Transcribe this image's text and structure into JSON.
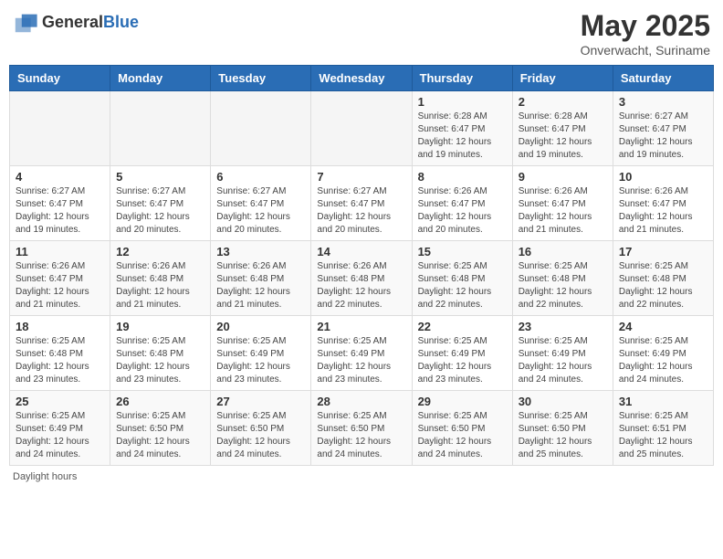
{
  "header": {
    "logo_general": "General",
    "logo_blue": "Blue",
    "main_title": "May 2025",
    "subtitle": "Onverwacht, Suriname"
  },
  "weekdays": [
    "Sunday",
    "Monday",
    "Tuesday",
    "Wednesday",
    "Thursday",
    "Friday",
    "Saturday"
  ],
  "weeks": [
    [
      {
        "day": "",
        "info": ""
      },
      {
        "day": "",
        "info": ""
      },
      {
        "day": "",
        "info": ""
      },
      {
        "day": "",
        "info": ""
      },
      {
        "day": "1",
        "info": "Sunrise: 6:28 AM\nSunset: 6:47 PM\nDaylight: 12 hours and 19 minutes."
      },
      {
        "day": "2",
        "info": "Sunrise: 6:28 AM\nSunset: 6:47 PM\nDaylight: 12 hours and 19 minutes."
      },
      {
        "day": "3",
        "info": "Sunrise: 6:27 AM\nSunset: 6:47 PM\nDaylight: 12 hours and 19 minutes."
      }
    ],
    [
      {
        "day": "4",
        "info": "Sunrise: 6:27 AM\nSunset: 6:47 PM\nDaylight: 12 hours and 19 minutes."
      },
      {
        "day": "5",
        "info": "Sunrise: 6:27 AM\nSunset: 6:47 PM\nDaylight: 12 hours and 20 minutes."
      },
      {
        "day": "6",
        "info": "Sunrise: 6:27 AM\nSunset: 6:47 PM\nDaylight: 12 hours and 20 minutes."
      },
      {
        "day": "7",
        "info": "Sunrise: 6:27 AM\nSunset: 6:47 PM\nDaylight: 12 hours and 20 minutes."
      },
      {
        "day": "8",
        "info": "Sunrise: 6:26 AM\nSunset: 6:47 PM\nDaylight: 12 hours and 20 minutes."
      },
      {
        "day": "9",
        "info": "Sunrise: 6:26 AM\nSunset: 6:47 PM\nDaylight: 12 hours and 21 minutes."
      },
      {
        "day": "10",
        "info": "Sunrise: 6:26 AM\nSunset: 6:47 PM\nDaylight: 12 hours and 21 minutes."
      }
    ],
    [
      {
        "day": "11",
        "info": "Sunrise: 6:26 AM\nSunset: 6:47 PM\nDaylight: 12 hours and 21 minutes."
      },
      {
        "day": "12",
        "info": "Sunrise: 6:26 AM\nSunset: 6:48 PM\nDaylight: 12 hours and 21 minutes."
      },
      {
        "day": "13",
        "info": "Sunrise: 6:26 AM\nSunset: 6:48 PM\nDaylight: 12 hours and 21 minutes."
      },
      {
        "day": "14",
        "info": "Sunrise: 6:26 AM\nSunset: 6:48 PM\nDaylight: 12 hours and 22 minutes."
      },
      {
        "day": "15",
        "info": "Sunrise: 6:25 AM\nSunset: 6:48 PM\nDaylight: 12 hours and 22 minutes."
      },
      {
        "day": "16",
        "info": "Sunrise: 6:25 AM\nSunset: 6:48 PM\nDaylight: 12 hours and 22 minutes."
      },
      {
        "day": "17",
        "info": "Sunrise: 6:25 AM\nSunset: 6:48 PM\nDaylight: 12 hours and 22 minutes."
      }
    ],
    [
      {
        "day": "18",
        "info": "Sunrise: 6:25 AM\nSunset: 6:48 PM\nDaylight: 12 hours and 23 minutes."
      },
      {
        "day": "19",
        "info": "Sunrise: 6:25 AM\nSunset: 6:48 PM\nDaylight: 12 hours and 23 minutes."
      },
      {
        "day": "20",
        "info": "Sunrise: 6:25 AM\nSunset: 6:49 PM\nDaylight: 12 hours and 23 minutes."
      },
      {
        "day": "21",
        "info": "Sunrise: 6:25 AM\nSunset: 6:49 PM\nDaylight: 12 hours and 23 minutes."
      },
      {
        "day": "22",
        "info": "Sunrise: 6:25 AM\nSunset: 6:49 PM\nDaylight: 12 hours and 23 minutes."
      },
      {
        "day": "23",
        "info": "Sunrise: 6:25 AM\nSunset: 6:49 PM\nDaylight: 12 hours and 24 minutes."
      },
      {
        "day": "24",
        "info": "Sunrise: 6:25 AM\nSunset: 6:49 PM\nDaylight: 12 hours and 24 minutes."
      }
    ],
    [
      {
        "day": "25",
        "info": "Sunrise: 6:25 AM\nSunset: 6:49 PM\nDaylight: 12 hours and 24 minutes."
      },
      {
        "day": "26",
        "info": "Sunrise: 6:25 AM\nSunset: 6:50 PM\nDaylight: 12 hours and 24 minutes."
      },
      {
        "day": "27",
        "info": "Sunrise: 6:25 AM\nSunset: 6:50 PM\nDaylight: 12 hours and 24 minutes."
      },
      {
        "day": "28",
        "info": "Sunrise: 6:25 AM\nSunset: 6:50 PM\nDaylight: 12 hours and 24 minutes."
      },
      {
        "day": "29",
        "info": "Sunrise: 6:25 AM\nSunset: 6:50 PM\nDaylight: 12 hours and 24 minutes."
      },
      {
        "day": "30",
        "info": "Sunrise: 6:25 AM\nSunset: 6:50 PM\nDaylight: 12 hours and 25 minutes."
      },
      {
        "day": "31",
        "info": "Sunrise: 6:25 AM\nSunset: 6:51 PM\nDaylight: 12 hours and 25 minutes."
      }
    ]
  ],
  "footer": {
    "daylight_label": "Daylight hours"
  }
}
